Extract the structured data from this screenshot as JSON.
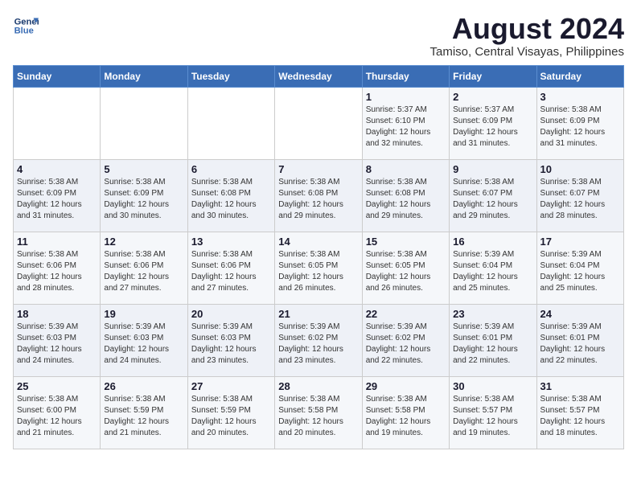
{
  "logo": {
    "line1": "General",
    "line2": "Blue"
  },
  "header": {
    "month_year": "August 2024",
    "location": "Tamiso, Central Visayas, Philippines"
  },
  "days_of_week": [
    "Sunday",
    "Monday",
    "Tuesday",
    "Wednesday",
    "Thursday",
    "Friday",
    "Saturday"
  ],
  "weeks": [
    [
      {
        "day": "",
        "info": ""
      },
      {
        "day": "",
        "info": ""
      },
      {
        "day": "",
        "info": ""
      },
      {
        "day": "",
        "info": ""
      },
      {
        "day": "1",
        "info": "Sunrise: 5:37 AM\nSunset: 6:10 PM\nDaylight: 12 hours\nand 32 minutes."
      },
      {
        "day": "2",
        "info": "Sunrise: 5:37 AM\nSunset: 6:09 PM\nDaylight: 12 hours\nand 31 minutes."
      },
      {
        "day": "3",
        "info": "Sunrise: 5:38 AM\nSunset: 6:09 PM\nDaylight: 12 hours\nand 31 minutes."
      }
    ],
    [
      {
        "day": "4",
        "info": "Sunrise: 5:38 AM\nSunset: 6:09 PM\nDaylight: 12 hours\nand 31 minutes."
      },
      {
        "day": "5",
        "info": "Sunrise: 5:38 AM\nSunset: 6:09 PM\nDaylight: 12 hours\nand 30 minutes."
      },
      {
        "day": "6",
        "info": "Sunrise: 5:38 AM\nSunset: 6:08 PM\nDaylight: 12 hours\nand 30 minutes."
      },
      {
        "day": "7",
        "info": "Sunrise: 5:38 AM\nSunset: 6:08 PM\nDaylight: 12 hours\nand 29 minutes."
      },
      {
        "day": "8",
        "info": "Sunrise: 5:38 AM\nSunset: 6:08 PM\nDaylight: 12 hours\nand 29 minutes."
      },
      {
        "day": "9",
        "info": "Sunrise: 5:38 AM\nSunset: 6:07 PM\nDaylight: 12 hours\nand 29 minutes."
      },
      {
        "day": "10",
        "info": "Sunrise: 5:38 AM\nSunset: 6:07 PM\nDaylight: 12 hours\nand 28 minutes."
      }
    ],
    [
      {
        "day": "11",
        "info": "Sunrise: 5:38 AM\nSunset: 6:06 PM\nDaylight: 12 hours\nand 28 minutes."
      },
      {
        "day": "12",
        "info": "Sunrise: 5:38 AM\nSunset: 6:06 PM\nDaylight: 12 hours\nand 27 minutes."
      },
      {
        "day": "13",
        "info": "Sunrise: 5:38 AM\nSunset: 6:06 PM\nDaylight: 12 hours\nand 27 minutes."
      },
      {
        "day": "14",
        "info": "Sunrise: 5:38 AM\nSunset: 6:05 PM\nDaylight: 12 hours\nand 26 minutes."
      },
      {
        "day": "15",
        "info": "Sunrise: 5:38 AM\nSunset: 6:05 PM\nDaylight: 12 hours\nand 26 minutes."
      },
      {
        "day": "16",
        "info": "Sunrise: 5:39 AM\nSunset: 6:04 PM\nDaylight: 12 hours\nand 25 minutes."
      },
      {
        "day": "17",
        "info": "Sunrise: 5:39 AM\nSunset: 6:04 PM\nDaylight: 12 hours\nand 25 minutes."
      }
    ],
    [
      {
        "day": "18",
        "info": "Sunrise: 5:39 AM\nSunset: 6:03 PM\nDaylight: 12 hours\nand 24 minutes."
      },
      {
        "day": "19",
        "info": "Sunrise: 5:39 AM\nSunset: 6:03 PM\nDaylight: 12 hours\nand 24 minutes."
      },
      {
        "day": "20",
        "info": "Sunrise: 5:39 AM\nSunset: 6:03 PM\nDaylight: 12 hours\nand 23 minutes."
      },
      {
        "day": "21",
        "info": "Sunrise: 5:39 AM\nSunset: 6:02 PM\nDaylight: 12 hours\nand 23 minutes."
      },
      {
        "day": "22",
        "info": "Sunrise: 5:39 AM\nSunset: 6:02 PM\nDaylight: 12 hours\nand 22 minutes."
      },
      {
        "day": "23",
        "info": "Sunrise: 5:39 AM\nSunset: 6:01 PM\nDaylight: 12 hours\nand 22 minutes."
      },
      {
        "day": "24",
        "info": "Sunrise: 5:39 AM\nSunset: 6:01 PM\nDaylight: 12 hours\nand 22 minutes."
      }
    ],
    [
      {
        "day": "25",
        "info": "Sunrise: 5:38 AM\nSunset: 6:00 PM\nDaylight: 12 hours\nand 21 minutes."
      },
      {
        "day": "26",
        "info": "Sunrise: 5:38 AM\nSunset: 5:59 PM\nDaylight: 12 hours\nand 21 minutes."
      },
      {
        "day": "27",
        "info": "Sunrise: 5:38 AM\nSunset: 5:59 PM\nDaylight: 12 hours\nand 20 minutes."
      },
      {
        "day": "28",
        "info": "Sunrise: 5:38 AM\nSunset: 5:58 PM\nDaylight: 12 hours\nand 20 minutes."
      },
      {
        "day": "29",
        "info": "Sunrise: 5:38 AM\nSunset: 5:58 PM\nDaylight: 12 hours\nand 19 minutes."
      },
      {
        "day": "30",
        "info": "Sunrise: 5:38 AM\nSunset: 5:57 PM\nDaylight: 12 hours\nand 19 minutes."
      },
      {
        "day": "31",
        "info": "Sunrise: 5:38 AM\nSunset: 5:57 PM\nDaylight: 12 hours\nand 18 minutes."
      }
    ]
  ]
}
